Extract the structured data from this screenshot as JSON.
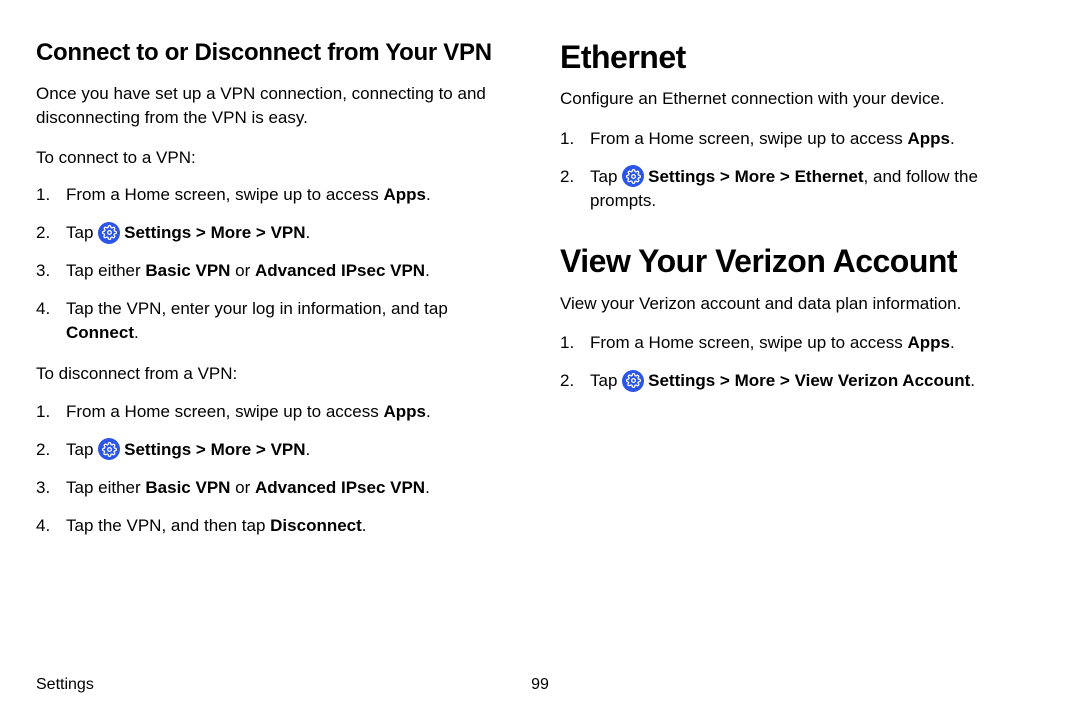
{
  "left": {
    "heading": "Connect to or Disconnect from Your VPN",
    "intro": "Once you have set up a VPN connection, connecting to and disconnecting from the VPN is easy.",
    "connect_lead": "To connect to a VPN:",
    "connect": {
      "s1_a": "From a Home screen, swipe up to access ",
      "s1_b": "Apps",
      "s1_c": ".",
      "s2_a": "Tap ",
      "s2_set": "Settings",
      "s2_ch1": " > ",
      "s2_more": "More",
      "s2_ch2": " > ",
      "s2_vpn": "VPN",
      "s2_end": ".",
      "s3_a": "Tap either ",
      "s3_b": "Basic VPN",
      "s3_c": " or ",
      "s3_d": "Advanced IPsec VPN",
      "s3_e": ".",
      "s4_a": "Tap the VPN, enter your log in information, and tap ",
      "s4_b": "Connect",
      "s4_c": "."
    },
    "disc_lead": "To disconnect from a VPN:",
    "disc": {
      "s1_a": "From a Home screen, swipe up to access ",
      "s1_b": "Apps",
      "s1_c": ".",
      "s2_a": "Tap ",
      "s2_set": "Settings",
      "s2_ch1": " > ",
      "s2_more": "More",
      "s2_ch2": " > ",
      "s2_vpn": "VPN",
      "s2_end": ".",
      "s3_a": "Tap either ",
      "s3_b": "Basic VPN",
      "s3_c": " or ",
      "s3_d": "Advanced IPsec VPN",
      "s3_e": ".",
      "s4_a": "Tap the VPN, and then tap ",
      "s4_b": "Disconnect",
      "s4_c": "."
    }
  },
  "right": {
    "eth_heading": "Ethernet",
    "eth_intro": "Configure an Ethernet connection with your device.",
    "eth": {
      "s1_a": "From a Home screen, swipe up to access ",
      "s1_b": "Apps",
      "s1_c": ".",
      "s2_a": "Tap ",
      "s2_set": "Settings",
      "s2_ch1": " > ",
      "s2_more": "More",
      "s2_ch2": " > ",
      "s2_eth": "Ethernet",
      "s2_tail": ", and follow the prompts."
    },
    "vz_heading": "View Your Verizon Account",
    "vz_intro": "View your Verizon account and data plan information.",
    "vz": {
      "s1_a": "From a Home screen, swipe up to access ",
      "s1_b": "Apps",
      "s1_c": ".",
      "s2_a": "Tap ",
      "s2_set": "Settings",
      "s2_ch1": " > ",
      "s2_more": "More",
      "s2_ch2": " > ",
      "s2_vva": "View Verizon Account",
      "s2_end": "."
    }
  },
  "footer": {
    "section": "Settings",
    "page": "99"
  },
  "icons": {
    "settings": "settings-icon"
  }
}
